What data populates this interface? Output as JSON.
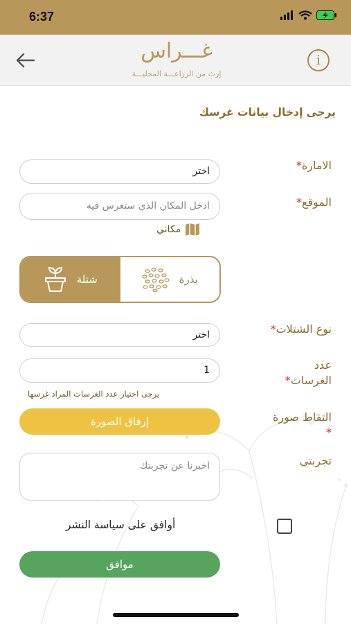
{
  "status_bar": {
    "time": "6:37"
  },
  "header": {
    "logo_text": "غـــراس",
    "tagline": "إرث من الزراعـــة المحليـــة"
  },
  "form": {
    "heading": "يرجى إدخال بيانات غرسك",
    "emirate": {
      "label": "الامارة",
      "required_mark": "*",
      "value": "اختر"
    },
    "location": {
      "label": "الموقع",
      "required_mark": "*",
      "placeholder": "ادخل المكان الذي ستغرس فيه",
      "map_link": "مكاني"
    },
    "plant_type_toggle": {
      "options": [
        "شتلة",
        "بذرة"
      ],
      "selected": "شتلة"
    },
    "seedling_type": {
      "label": "نوع الشتلات",
      "required_mark": "*",
      "value": "اختر"
    },
    "count": {
      "label_line1": "عدد",
      "label_line2": "الغرسات",
      "required_mark": "*",
      "value": "1",
      "hint": "يرجى اختيار عدد الغرسات المراد غرسها"
    },
    "photo": {
      "label": "التقاط صورة",
      "required_mark": "*",
      "button": "إرفاق الصورة"
    },
    "experience": {
      "label": "تجربتي",
      "placeholder": "اخبرنا عن تجربتك"
    },
    "agree_text": "أوافق على سياسة النشر",
    "submit": "موافق"
  },
  "colors": {
    "brand": "#b8975a",
    "attach_button": "#eec242",
    "submit_button": "#57a45c",
    "required": "#d22b2b"
  }
}
